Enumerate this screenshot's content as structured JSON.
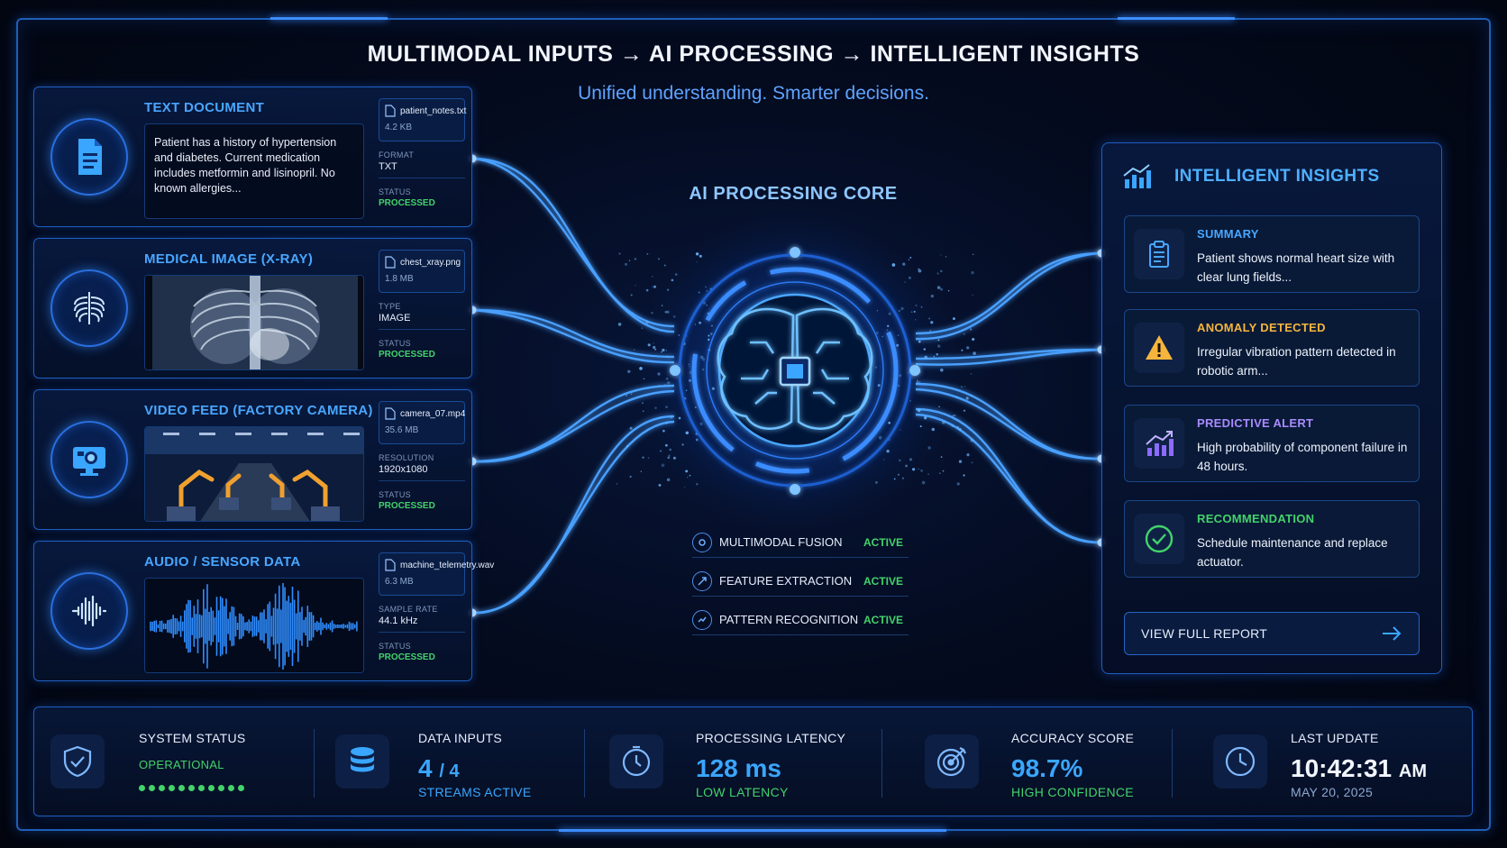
{
  "header": {
    "title": "MULTIMODAL INPUTS → AI PROCESSING → INTELLIGENT INSIGHTS",
    "subtitle": "Unified understanding. Smarter decisions."
  },
  "inputs": [
    {
      "title": "TEXT DOCUMENT",
      "icon": "document-icon",
      "content_text": "Patient has a history of hypertension and diabetes. Current medication includes metformin and lisinopril. No known allergies...",
      "file": "patient_notes.txt",
      "size": "4.2 KB",
      "meta_key": "FORMAT",
      "meta_value": "TXT",
      "status_key": "STATUS",
      "status": "PROCESSED"
    },
    {
      "title": "MEDICAL IMAGE (X-RAY)",
      "icon": "ribcage-icon",
      "file": "chest_xray.png",
      "size": "1.8 MB",
      "meta_key": "TYPE",
      "meta_value": "IMAGE",
      "status_key": "STATUS",
      "status": "PROCESSED"
    },
    {
      "title": "VIDEO FEED (FACTORY CAMERA)",
      "icon": "camera-monitor-icon",
      "file": "camera_07.mp4",
      "size": "35.6 MB",
      "meta_key": "RESOLUTION",
      "meta_value": "1920x1080",
      "status_key": "STATUS",
      "status": "PROCESSED"
    },
    {
      "title": "AUDIO / SENSOR DATA",
      "icon": "waveform-icon",
      "file": "machine_telemetry.wav",
      "size": "6.3 MB",
      "meta_key": "SAMPLE RATE",
      "meta_value": "44.1 kHz",
      "status_key": "STATUS",
      "status": "PROCESSED"
    }
  ],
  "core": {
    "title": "AI PROCESSING CORE",
    "statuses": [
      {
        "label": "MULTIMODAL FUSION",
        "value": "ACTIVE"
      },
      {
        "label": "FEATURE EXTRACTION",
        "value": "ACTIVE"
      },
      {
        "label": "PATTERN RECOGNITION",
        "value": "ACTIVE"
      }
    ]
  },
  "insights": {
    "title": "INTELLIGENT INSIGHTS",
    "items": [
      {
        "label": "SUMMARY",
        "text": "Patient shows normal heart size with clear lung fields...",
        "color": "#49a6ff",
        "icon": "clipboard-icon"
      },
      {
        "label": "ANOMALY DETECTED",
        "text": "Irregular vibration pattern detected in robotic arm...",
        "color": "#f5b53d",
        "icon": "warning-icon"
      },
      {
        "label": "PREDICTIVE ALERT",
        "text": "High probability of component failure in 48 hours.",
        "color": "#a98bff",
        "icon": "trend-up-icon"
      },
      {
        "label": "RECOMMENDATION",
        "text": "Schedule maintenance and replace actuator.",
        "color": "#43d26b",
        "icon": "check-circle-icon"
      }
    ],
    "report_button": "VIEW FULL REPORT"
  },
  "stats": {
    "system": {
      "label": "SYSTEM STATUS",
      "value": "OPERATIONAL",
      "indicator_dots": 11
    },
    "inputs": {
      "label": "DATA INPUTS",
      "value": "4",
      "total": "/ 4",
      "sub": "STREAMS ACTIVE"
    },
    "latency": {
      "label": "PROCESSING LATENCY",
      "value": "128 ms",
      "sub": "LOW LATENCY"
    },
    "accuracy": {
      "label": "ACCURACY SCORE",
      "value": "98.7%",
      "sub": "HIGH CONFIDENCE"
    },
    "update": {
      "label": "LAST UPDATE",
      "time": "10:42:31",
      "ampm": "AM",
      "date": "MAY 20, 2025"
    }
  },
  "colors": {
    "accent": "#3aa6ff",
    "success": "#43d26b",
    "warning": "#f5b53d",
    "alert": "#a98bff",
    "border": "#1e5fc0"
  }
}
